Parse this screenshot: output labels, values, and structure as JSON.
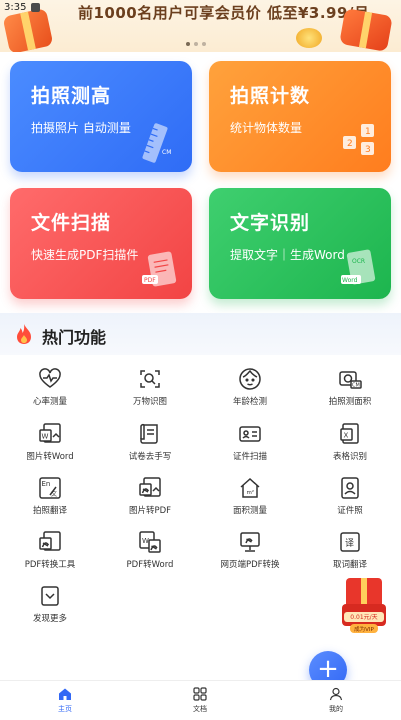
{
  "status_bar": {
    "time": "3:35"
  },
  "banner": {
    "text": "前1000名用户可享会员价 低至¥3.99/月"
  },
  "cards": [
    {
      "title": "拍照测高",
      "subtitle": "拍摄照片 自动测量",
      "deco_text": "CM"
    },
    {
      "title": "拍照计数",
      "subtitle": "统计物体数量",
      "deco_text": "1 2 3"
    },
    {
      "title": "文件扫描",
      "subtitle": "快速生成PDF扫描件",
      "deco_text": "PDF"
    },
    {
      "title": "文字识别",
      "subtitle": "提取文字｜生成Word",
      "deco_text": "OCR",
      "deco_text2": "Word"
    }
  ],
  "section": {
    "title": "热门功能"
  },
  "features": [
    {
      "label": "心率测量",
      "icon": "heart-pulse-icon"
    },
    {
      "label": "万物识图",
      "icon": "scan-image-icon"
    },
    {
      "label": "年龄检测",
      "icon": "face-icon"
    },
    {
      "label": "拍照测面积",
      "icon": "camera-area-icon"
    },
    {
      "label": "图片转Word",
      "icon": "image-to-word-icon"
    },
    {
      "label": "试卷去手写",
      "icon": "paper-erase-icon"
    },
    {
      "label": "证件扫描",
      "icon": "id-card-icon"
    },
    {
      "label": "表格识别",
      "icon": "table-icon"
    },
    {
      "label": "拍照翻译",
      "icon": "translate-icon"
    },
    {
      "label": "图片转PDF",
      "icon": "image-to-pdf-icon"
    },
    {
      "label": "面积测量",
      "icon": "house-area-icon"
    },
    {
      "label": "证件照",
      "icon": "id-photo-icon"
    },
    {
      "label": "PDF转换工具",
      "icon": "pdf-convert-icon"
    },
    {
      "label": "PDF转Word",
      "icon": "pdf-to-word-icon"
    },
    {
      "label": "网页端PDF转换",
      "icon": "web-pdf-icon"
    },
    {
      "label": "取词翻译",
      "icon": "word-translate-icon"
    },
    {
      "label": "发现更多",
      "icon": "chevron-down-icon"
    }
  ],
  "float_gift": {
    "price": "0.01元/天",
    "badge": "成为VIP"
  },
  "fab": {
    "label": "+"
  },
  "tabs": [
    {
      "label": "主页",
      "icon": "home-icon",
      "active": true
    },
    {
      "label": "文档",
      "icon": "grid-icon",
      "active": false
    },
    {
      "label": "我的",
      "icon": "user-icon",
      "active": false
    }
  ],
  "colors": {
    "accent": "#3268f5",
    "card_blue": "#2f6cf6",
    "card_orange": "#ff7d1e",
    "card_red": "#f24444",
    "card_green": "#1db54e"
  }
}
